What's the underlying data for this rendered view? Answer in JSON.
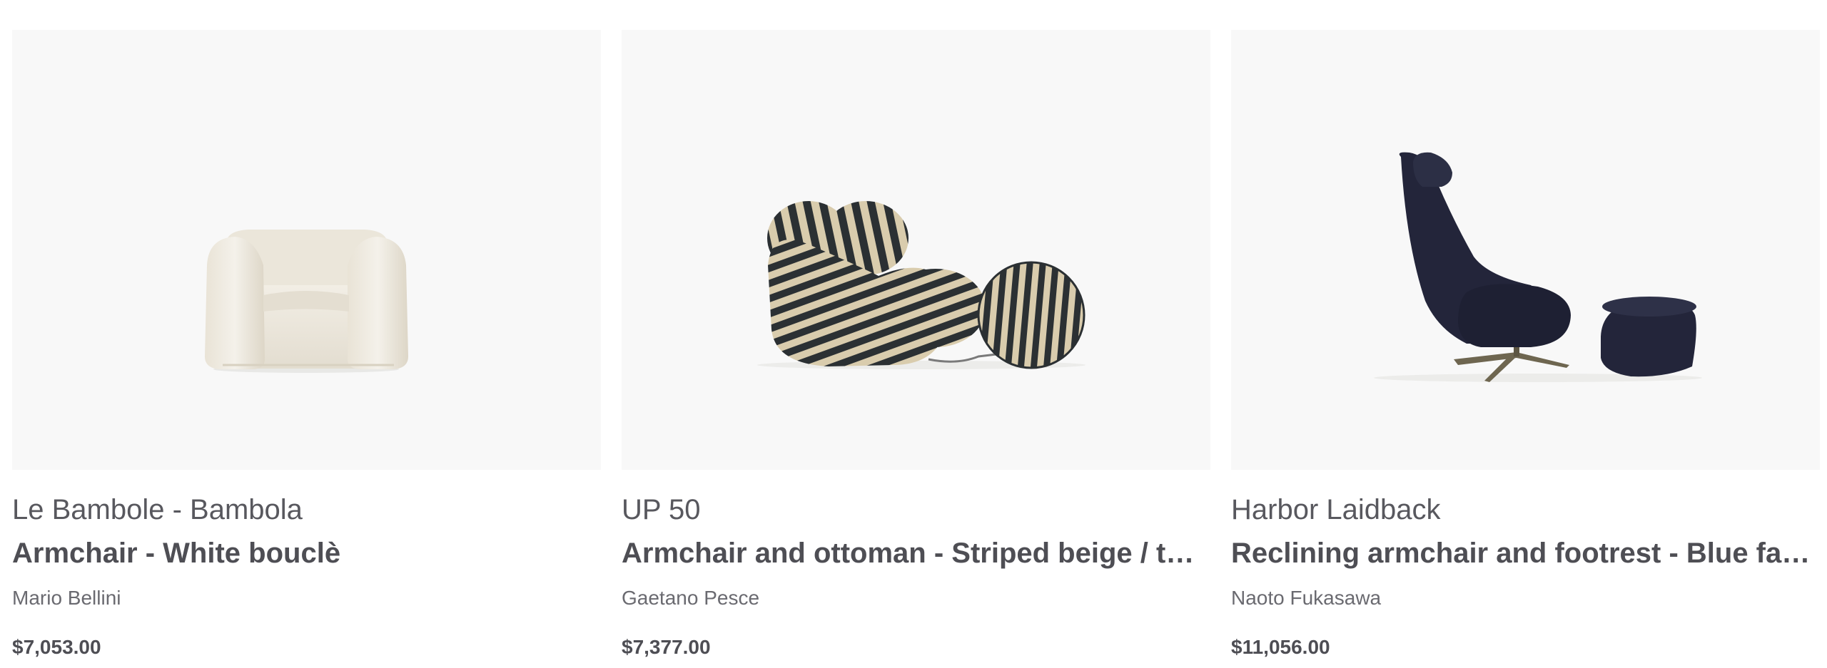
{
  "products": [
    {
      "collection": "Le Bambole - Bambola",
      "name": "Armchair - White bouclè",
      "designer": "Mario Bellini",
      "price": "$7,053.00",
      "image_icon": "white-boucle-armchair-image"
    },
    {
      "collection": "UP 50",
      "name": "Armchair and ottoman - Striped beige / turquoise",
      "designer": "Gaetano Pesce",
      "price": "$7,377.00",
      "image_icon": "striped-armchair-ottoman-image"
    },
    {
      "collection": "Harbor Laidback",
      "name": "Reclining armchair and footrest - Blue fabric",
      "designer": "Naoto Fukasawa",
      "price": "$11,056.00",
      "image_icon": "blue-reclining-armchair-footrest-image"
    }
  ],
  "colors": {
    "image_background": "#f8f8f8",
    "text_primary": "#4e4e54",
    "text_secondary": "#6a6a70",
    "boucle_white": "#ece7dc",
    "stripe_beige": "#d9ccad",
    "stripe_dark": "#2b3033",
    "fabric_navy": "#23253a",
    "base_bronze": "#6e6650"
  }
}
